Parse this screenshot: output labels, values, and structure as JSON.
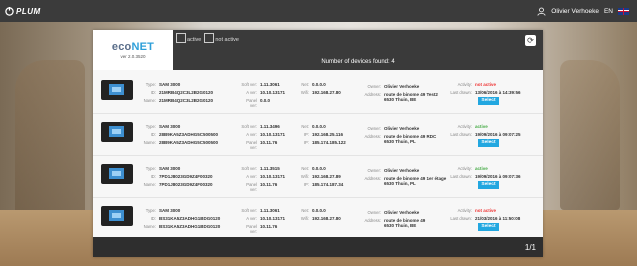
{
  "topbar": {
    "logo": "PLUM",
    "user": "Olivier Verhoeke",
    "lang": "EN"
  },
  "brand": {
    "name_prefix": "eco",
    "name_suffix": "NET",
    "version": "ver 2.0.3520"
  },
  "filters": {
    "active_label": "active",
    "not_active_label": "not active"
  },
  "devices_found": "Number of devices found: 4",
  "pager": "1/1",
  "labels": {
    "type": "Type:",
    "id": "ID:",
    "name": "Name:",
    "soft": "Soft ver:",
    "amodule": "A ver:",
    "panel": "Panel ver:",
    "net": "Net:",
    "wifi": "Wifi:",
    "ip": "IP:",
    "owner": "Owner:",
    "address": "Address:",
    "activity": "Activity:",
    "last_drawn": "Last drawn:",
    "select": "Select"
  },
  "devices": [
    {
      "type": "SAM 3000",
      "id": "21MRB4Q2C3L2B2G0120",
      "name": "21MRB4Q2C3L2B2G0120",
      "soft": "1.11.3061",
      "amodule": "10.10.13171",
      "panel": "0.0.0",
      "net_label": "Net:",
      "net": "0.0.0.0",
      "ip_label": "Wifi:",
      "ip": "192.168.27.80",
      "owner": "Olivier Verhoeke",
      "address1": "route de binome 49 Test2",
      "address2": "6530 Thuin, BE",
      "activity": "not active",
      "last": "13/06/2016 à 14:39:56"
    },
    {
      "type": "SAM 3000",
      "id": "28B9KA5Z3ADHG5C500500",
      "name": "28B9KA5Z3ADHG5C500500",
      "soft": "1.11.3496",
      "amodule": "10.10.13171",
      "panel": "10.11.76",
      "net_label": "Net:",
      "net": "0.0.0.0",
      "ip_label": "IP:",
      "ip": "192.168.25.116",
      "ip2_label": "IP:",
      "ip2": "185.174.185.122",
      "owner": "Olivier Verhoeke",
      "address1": "route de binome 49 RDC",
      "address2": "6530 Thuin, PL",
      "activity": "active",
      "last": "19/09/2016 à 09:07:25"
    },
    {
      "type": "SAM 3000",
      "id": "7PD1J8023GD9Z4F00320",
      "name": "7PD1J8023GD9Z4F00320",
      "soft": "1.11.3515",
      "amodule": "10.10.13171",
      "panel": "10.11.76",
      "net_label": "Net:",
      "net": "0.0.0.0",
      "ip_label": "Wifi:",
      "ip": "192.168.27.89",
      "ip2_label": "IP:",
      "ip2": "185.174.187.34",
      "owner": "Olivier Verhoeke",
      "address1": "route de binome 49 1er étage",
      "address2": "6530 Thuin, PL",
      "activity": "active",
      "last": "19/09/2016 à 09:07:36"
    },
    {
      "type": "SAM 3000",
      "id": "BS31KA5Z3ADHG1BDG0120",
      "name": "BS31KA5Z3ADHG1BDG0120",
      "soft": "1.11.3061",
      "amodule": "10.10.13171",
      "panel": "10.11.76",
      "net_label": "Net:",
      "net": "0.0.0.0",
      "ip_label": "Wifi:",
      "ip": "192.168.27.80",
      "owner": "Olivier Verhoeke",
      "address1": "route de binome 49",
      "address2": "6530 Thuin, BE",
      "activity": "not active",
      "last": "21/03/2016 à 11:50:08"
    }
  ],
  "colors": {
    "accent": "#22a7e0",
    "active": "#44aa44",
    "inactive": "#ee3333",
    "header": "#3a3a3a"
  },
  "icons": {
    "logo": "plum-logo-icon",
    "user": "user-icon",
    "flag": "uk-flag-icon",
    "refresh": "refresh-icon",
    "device": "thermostat-icon"
  }
}
